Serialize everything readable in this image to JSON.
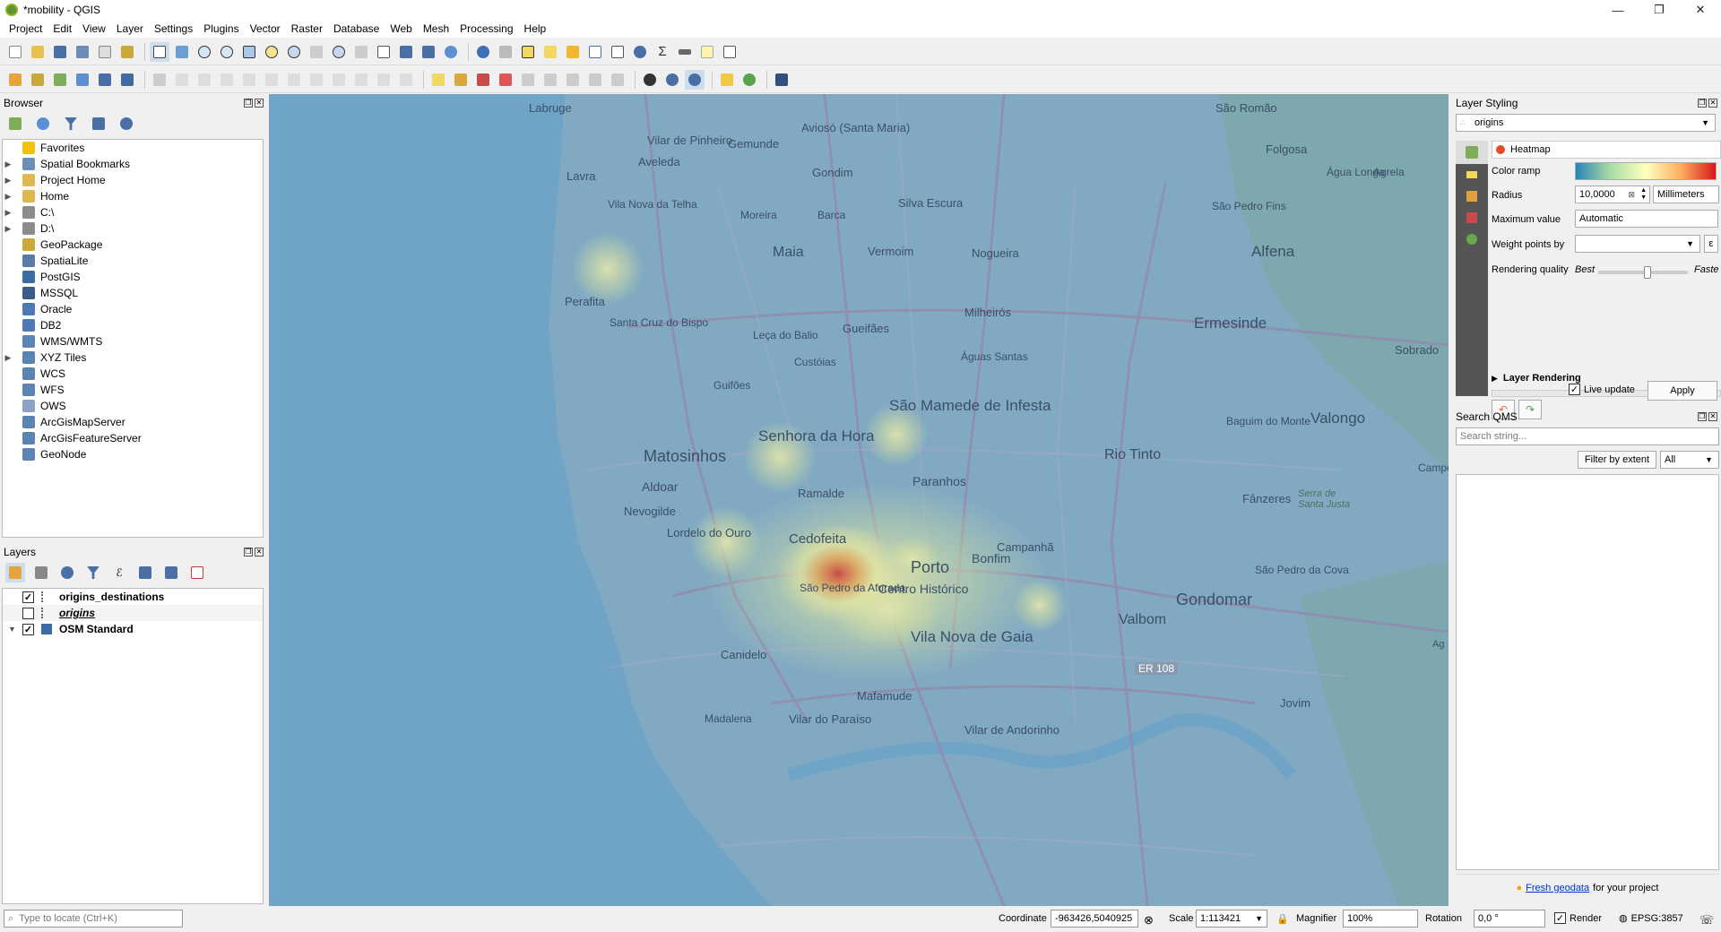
{
  "window": {
    "title": "*mobility - QGIS",
    "minimize": "—",
    "restore": "❐",
    "close": "✕"
  },
  "menu": [
    "Project",
    "Edit",
    "View",
    "Layer",
    "Settings",
    "Plugins",
    "Vector",
    "Raster",
    "Database",
    "Web",
    "Mesh",
    "Processing",
    "Help"
  ],
  "browser": {
    "title": "Browser",
    "items": [
      {
        "label": "Favorites",
        "expandable": false,
        "icon": "star-icon",
        "color": "#f2c20f"
      },
      {
        "label": "Spatial Bookmarks",
        "expandable": true,
        "icon": "bookmark-icon",
        "color": "#6c8fb8"
      },
      {
        "label": "Project Home",
        "expandable": true,
        "icon": "folder-icon",
        "color": "#e0b850"
      },
      {
        "label": "Home",
        "expandable": true,
        "icon": "folder-icon",
        "color": "#e0b850"
      },
      {
        "label": "C:\\",
        "expandable": true,
        "icon": "drive-icon",
        "color": "#8c8c8c"
      },
      {
        "label": "D:\\",
        "expandable": true,
        "icon": "drive-icon",
        "color": "#8c8c8c"
      },
      {
        "label": "GeoPackage",
        "expandable": false,
        "icon": "geopackage-icon",
        "color": "#c9a93a"
      },
      {
        "label": "SpatiaLite",
        "expandable": false,
        "icon": "spatialite-icon",
        "color": "#5b7aa8"
      },
      {
        "label": "PostGIS",
        "expandable": false,
        "icon": "postgis-icon",
        "color": "#3d6ba4"
      },
      {
        "label": "MSSQL",
        "expandable": false,
        "icon": "mssql-icon",
        "color": "#3c5a8a"
      },
      {
        "label": "Oracle",
        "expandable": false,
        "icon": "oracle-icon",
        "color": "#4e79b5"
      },
      {
        "label": "DB2",
        "expandable": false,
        "icon": "db2-icon",
        "color": "#4e79b5"
      },
      {
        "label": "WMS/WMTS",
        "expandable": false,
        "icon": "globe-icon",
        "color": "#5c84b1"
      },
      {
        "label": "XYZ Tiles",
        "expandable": true,
        "icon": "tiles-icon",
        "color": "#5c84b1"
      },
      {
        "label": "WCS",
        "expandable": false,
        "icon": "globe-icon",
        "color": "#5c84b1"
      },
      {
        "label": "WFS",
        "expandable": false,
        "icon": "globe-icon",
        "color": "#5c84b1"
      },
      {
        "label": "OWS",
        "expandable": false,
        "icon": "globe-icon",
        "color": "#8ca5c5"
      },
      {
        "label": "ArcGisMapServer",
        "expandable": false,
        "icon": "globe-icon",
        "color": "#5c84b1"
      },
      {
        "label": "ArcGisFeatureServer",
        "expandable": false,
        "icon": "globe-icon",
        "color": "#5c84b1"
      },
      {
        "label": "GeoNode",
        "expandable": false,
        "icon": "geonode-icon",
        "color": "#5c84b1"
      }
    ]
  },
  "layers": {
    "title": "Layers",
    "items": [
      {
        "label": "origins_destinations",
        "checked": true,
        "italic": false,
        "underline": false
      },
      {
        "label": "origins",
        "checked": false,
        "italic": true,
        "underline": true
      },
      {
        "label": "OSM Standard",
        "checked": true,
        "italic": false,
        "underline": false
      }
    ]
  },
  "styling": {
    "title": "Layer Styling",
    "layer": "origins",
    "renderer": "Heatmap",
    "color_ramp_label": "Color ramp",
    "radius_label": "Radius",
    "radius_value": "10,0000",
    "radius_unit": "Millimeters",
    "max_label": "Maximum value",
    "max_value": "Automatic",
    "weight_label": "Weight points by",
    "quality_label": "Rendering quality",
    "quality_best": "Best",
    "quality_fast": "Faste",
    "quality_level": 0.55,
    "layer_rendering": "Layer Rendering",
    "live_update": "Live update",
    "apply": "Apply"
  },
  "qms": {
    "title": "Search QMS",
    "placeholder": "Search string...",
    "filter_btn": "Filter by extent",
    "filter_select": "All",
    "footer_link": "Fresh geodata",
    "footer_text": "for your project"
  },
  "status": {
    "locate_placeholder": "Type to locate (Ctrl+K)",
    "coord_label": "Coordinate",
    "coord_value": "-963426,5040925",
    "scale_label": "Scale",
    "scale_value": "1:113421",
    "magnifier_label": "Magnifier",
    "magnifier_value": "100%",
    "rotation_label": "Rotation",
    "rotation_value": "0,0 °",
    "render_label": "Render",
    "crs": "EPSG:3857"
  },
  "map_labels": [
    {
      "text": "Labruge"
    },
    {
      "text": "São Romão"
    },
    {
      "text": "Vilar de Pinheiro"
    },
    {
      "text": "Gemunde"
    },
    {
      "text": "Aviosó (Santa Maria)"
    },
    {
      "text": "Folgosa"
    },
    {
      "text": "Aveleda"
    },
    {
      "text": "Lavra"
    },
    {
      "text": "Gondim"
    },
    {
      "text": "Água Longa"
    },
    {
      "text": "Agrela"
    },
    {
      "text": "Vila Nova da Telha"
    },
    {
      "text": "Moreira"
    },
    {
      "text": "Barca"
    },
    {
      "text": "Silva Escura"
    },
    {
      "text": "São Pedro Fins"
    },
    {
      "text": "Maia"
    },
    {
      "text": "Vermoim"
    },
    {
      "text": "Nogueira"
    },
    {
      "text": "Alfena"
    },
    {
      "text": "Perafita"
    },
    {
      "text": "Santa Cruz do Bispo"
    },
    {
      "text": "Leça do Balio"
    },
    {
      "text": "Milheirós"
    },
    {
      "text": "Gueifães"
    },
    {
      "text": "Ermesinde"
    },
    {
      "text": "Custóias"
    },
    {
      "text": "Águas Santas"
    },
    {
      "text": "Sobrado"
    },
    {
      "text": "Guifões"
    },
    {
      "text": "São Mamede de Infesta"
    },
    {
      "text": "Baguim do Monte"
    },
    {
      "text": "Valongo"
    },
    {
      "text": "Senhora da Hora"
    },
    {
      "text": "Matosinhos"
    },
    {
      "text": "Rio Tinto"
    },
    {
      "text": "Aldoar"
    },
    {
      "text": "Ramalde"
    },
    {
      "text": "Paranhos"
    },
    {
      "text": "Fânzeres"
    },
    {
      "text": "Campo"
    },
    {
      "text": "Nevogilde"
    },
    {
      "text": "Serra de Santa Justa"
    },
    {
      "text": "Lordelo do Ouro"
    },
    {
      "text": "Cedofeita"
    },
    {
      "text": "Campanhã"
    },
    {
      "text": "Porto"
    },
    {
      "text": "Bonfim"
    },
    {
      "text": "Centro Histórico"
    },
    {
      "text": "São Pedro da Afurada"
    },
    {
      "text": "São Pedro da Cova"
    },
    {
      "text": "Gondomar"
    },
    {
      "text": "Valbom"
    },
    {
      "text": "Vila Nova de Gaia"
    },
    {
      "text": "Ag"
    },
    {
      "text": "Canidelo"
    },
    {
      "text": "ER 108"
    },
    {
      "text": "Mafamude"
    },
    {
      "text": "Jovim"
    },
    {
      "text": "Madalena"
    },
    {
      "text": "Vilar do Paraíso"
    },
    {
      "text": "Vilar de Andorinho"
    }
  ]
}
